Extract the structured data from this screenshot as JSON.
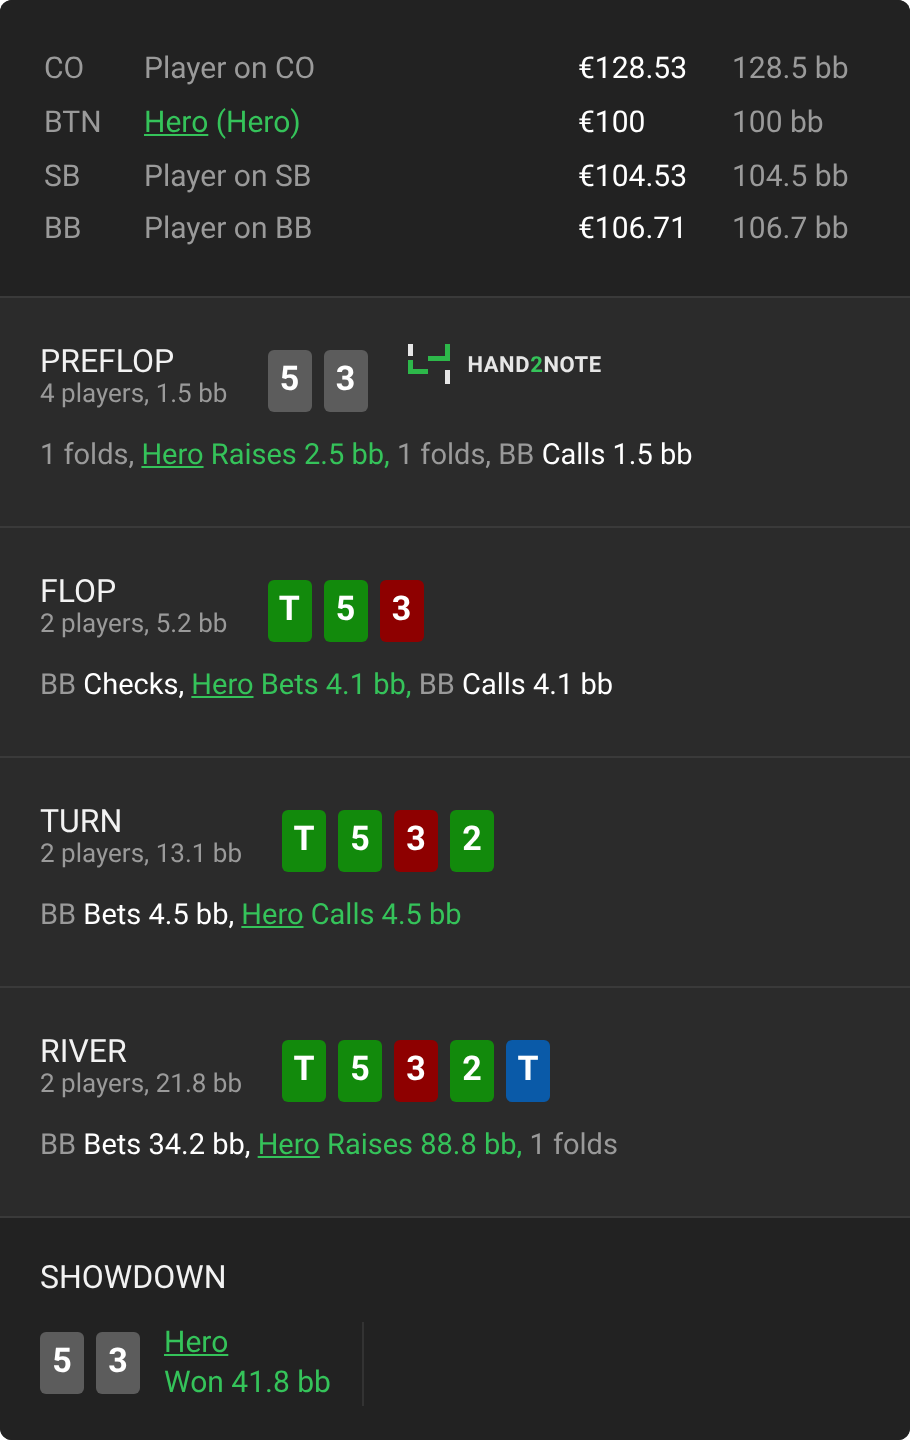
{
  "players": [
    {
      "position": "CO",
      "name": [
        {
          "kind": "plain",
          "text": "Player on CO"
        }
      ],
      "stack": "€128.53",
      "bb": "128.5 bb"
    },
    {
      "position": "BTN",
      "name": [
        {
          "kind": "link",
          "text": "Hero"
        },
        {
          "kind": "hero",
          "text": " (Hero)"
        }
      ],
      "stack": "€100",
      "bb": "100 bb"
    },
    {
      "position": "SB",
      "name": [
        {
          "kind": "plain",
          "text": "Player on SB"
        }
      ],
      "stack": "€104.53",
      "bb": "104.5 bb"
    },
    {
      "position": "BB",
      "name": [
        {
          "kind": "plain",
          "text": "Player on BB"
        }
      ],
      "stack": "€106.71",
      "bb": "106.7 bb"
    }
  ],
  "streets": [
    {
      "title": "PREFLOP",
      "summary": "4 players, 1.5 bb",
      "cards": [
        {
          "rank": "5",
          "color": "#5c5c5c"
        },
        {
          "rank": "3",
          "color": "#5c5c5c"
        }
      ],
      "logo": [
        {
          "kind": "plain",
          "text": "HAND"
        },
        {
          "kind": "accent",
          "text": "2"
        },
        {
          "kind": "plain",
          "text": "NOTE"
        }
      ],
      "actions": [
        {
          "kind": "muted",
          "text": "1 folds, "
        },
        {
          "kind": "link",
          "text": "Hero"
        },
        {
          "kind": "hero",
          "text": " Raises 2.5 bb,"
        },
        {
          "kind": "muted",
          "text": " 1 folds, BB "
        },
        {
          "kind": "strong",
          "text": "Calls 1.5 bb"
        }
      ]
    },
    {
      "title": "FLOP",
      "summary": "2 players, 5.2 bb",
      "cards": [
        {
          "rank": "T",
          "color": "#128a0c"
        },
        {
          "rank": "5",
          "color": "#128a0c"
        },
        {
          "rank": "3",
          "color": "#8e0000"
        }
      ],
      "actions": [
        {
          "kind": "muted",
          "text": "BB "
        },
        {
          "kind": "strong",
          "text": "Checks, "
        },
        {
          "kind": "link",
          "text": "Hero"
        },
        {
          "kind": "hero",
          "text": " Bets 4.1 bb,"
        },
        {
          "kind": "muted",
          "text": " BB "
        },
        {
          "kind": "strong",
          "text": "Calls 4.1 bb"
        }
      ]
    },
    {
      "title": "TURN",
      "summary": "2 players, 13.1 bb",
      "cards": [
        {
          "rank": "T",
          "color": "#128a0c"
        },
        {
          "rank": "5",
          "color": "#128a0c"
        },
        {
          "rank": "3",
          "color": "#8e0000"
        },
        {
          "rank": "2",
          "color": "#128a0c"
        }
      ],
      "actions": [
        {
          "kind": "muted",
          "text": "BB "
        },
        {
          "kind": "strong",
          "text": "Bets 4.5 bb, "
        },
        {
          "kind": "link",
          "text": "Hero"
        },
        {
          "kind": "hero",
          "text": " Calls 4.5 bb"
        }
      ]
    },
    {
      "title": "RIVER",
      "summary": "2 players, 21.8 bb",
      "cards": [
        {
          "rank": "T",
          "color": "#128a0c"
        },
        {
          "rank": "5",
          "color": "#128a0c"
        },
        {
          "rank": "3",
          "color": "#8e0000"
        },
        {
          "rank": "2",
          "color": "#128a0c"
        },
        {
          "rank": "T",
          "color": "#0a5aa8"
        }
      ],
      "actions": [
        {
          "kind": "muted",
          "text": "BB "
        },
        {
          "kind": "strong",
          "text": "Bets 34.2 bb, "
        },
        {
          "kind": "link",
          "text": "Hero"
        },
        {
          "kind": "hero",
          "text": " Raises 88.8 bb,"
        },
        {
          "kind": "muted",
          "text": " 1 folds"
        }
      ]
    }
  ],
  "showdown": {
    "title": "SHOWDOWN",
    "hands": [
      {
        "cards": [
          {
            "rank": "5",
            "color": "#5c5c5c"
          },
          {
            "rank": "3",
            "color": "#5c5c5c"
          }
        ],
        "player": "Hero",
        "result": "Won 41.8 bb"
      }
    ]
  }
}
